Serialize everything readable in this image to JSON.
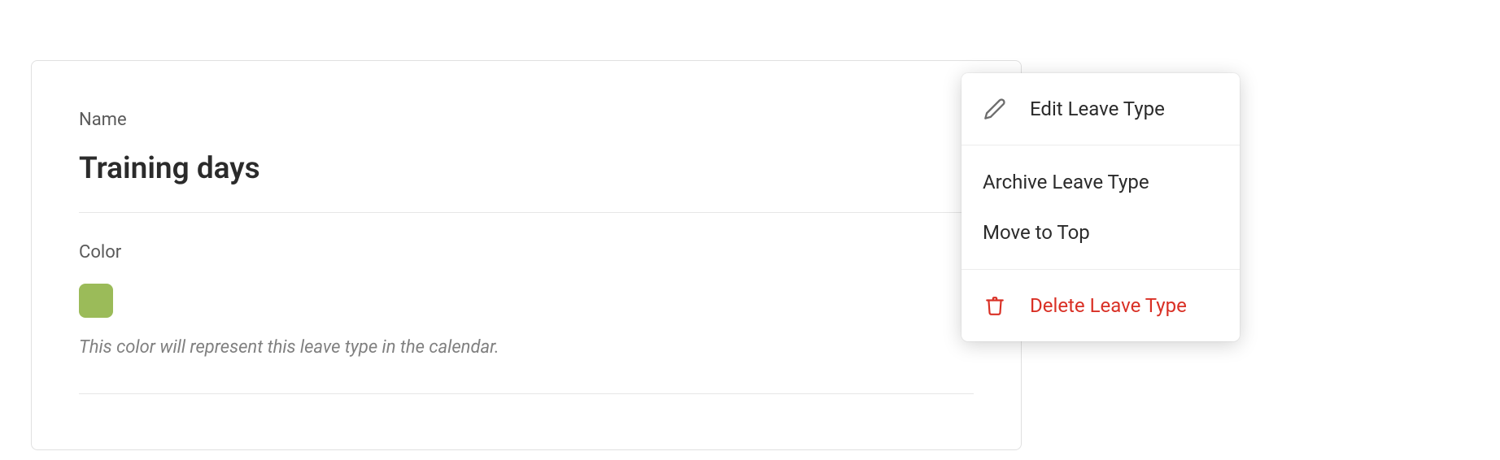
{
  "card": {
    "name_label": "Name",
    "name_value": "Training days",
    "color_label": "Color",
    "color_value": "#9bbb59",
    "color_help": "This color will represent this leave type in the calendar."
  },
  "menu": {
    "edit": "Edit Leave Type",
    "archive": "Archive Leave Type",
    "move_top": "Move to Top",
    "delete": "Delete Leave Type"
  },
  "colors": {
    "danger": "#d93025",
    "icon_gray": "#6d6d6d"
  }
}
